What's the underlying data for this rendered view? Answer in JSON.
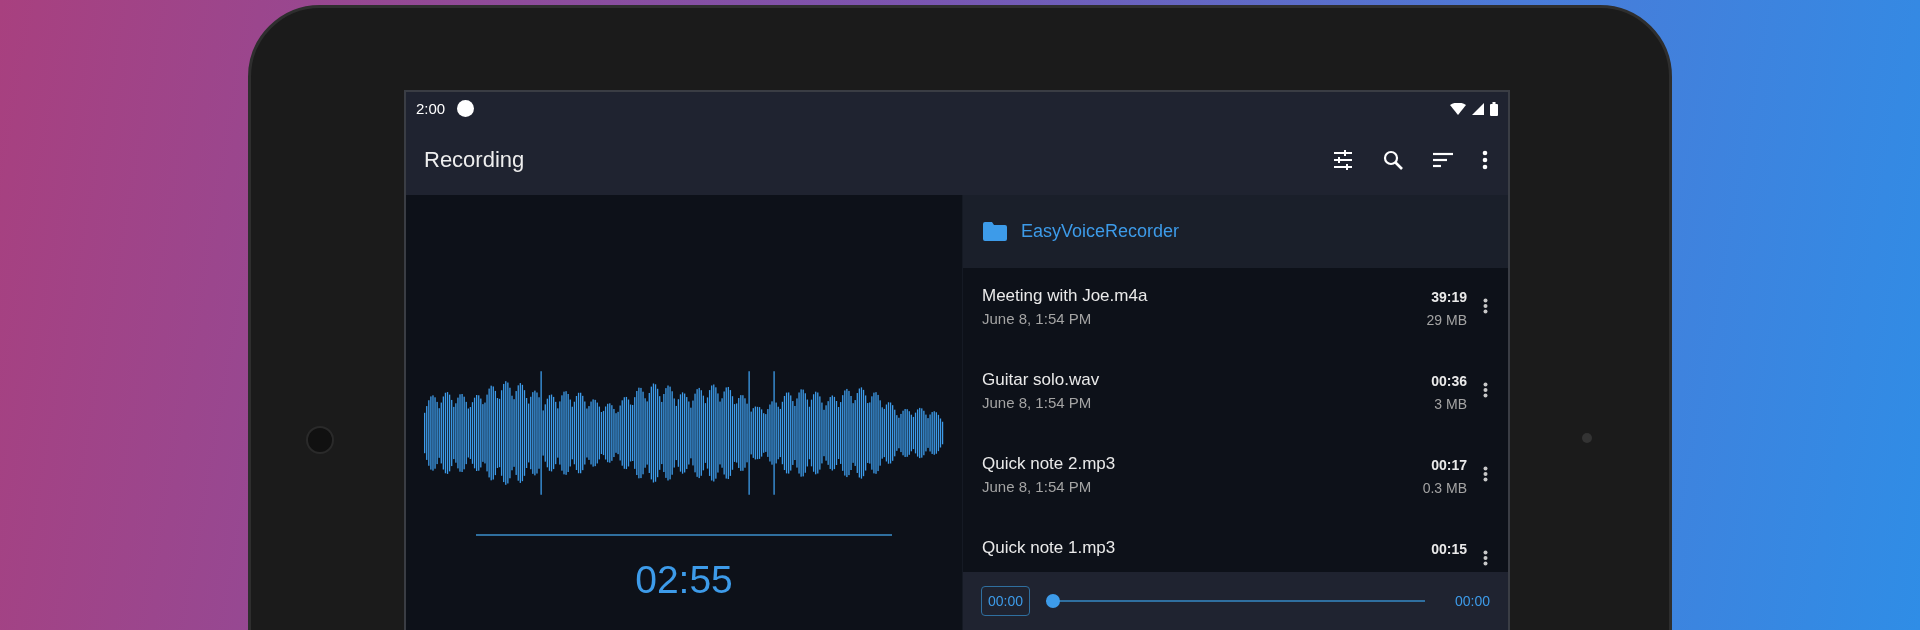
{
  "status_bar": {
    "time": "2:00"
  },
  "app_bar": {
    "title": "Recording"
  },
  "recorder": {
    "elapsed": "02:55"
  },
  "folder": {
    "name": "EasyVoiceRecorder"
  },
  "recordings": [
    {
      "name": "Meeting with Joe.m4a",
      "date": "June 8, 1:54 PM",
      "duration": "39:19",
      "size": "29 MB"
    },
    {
      "name": "Guitar solo.wav",
      "date": "June 8, 1:54 PM",
      "duration": "00:36",
      "size": "3 MB"
    },
    {
      "name": "Quick note 2.mp3",
      "date": "June 8, 1:54 PM",
      "duration": "00:17",
      "size": "0.3 MB"
    },
    {
      "name": "Quick note 1.mp3",
      "duration": "00:15"
    }
  ],
  "player": {
    "position": "00:00",
    "duration": "00:00",
    "level": 0
  }
}
